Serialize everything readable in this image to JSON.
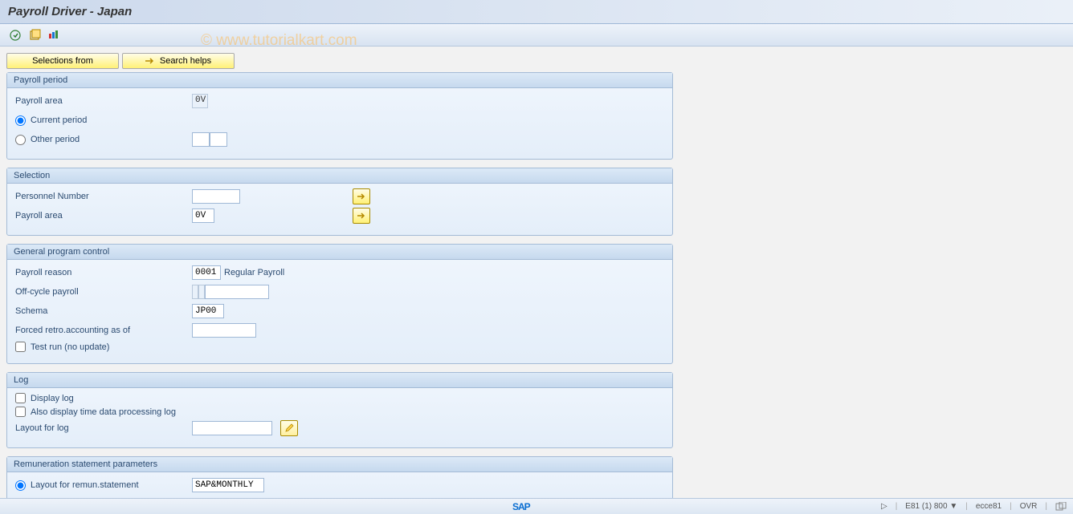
{
  "title": "Payroll Driver - Japan",
  "watermark": "© www.tutorialkart.com",
  "buttons": {
    "selections_from": "Selections from",
    "search_helps": "Search helps"
  },
  "panels": {
    "payroll_period": {
      "title": "Payroll period",
      "payroll_area_label": "Payroll area",
      "payroll_area_value": "0V",
      "current_period": "Current period",
      "other_period": "Other period"
    },
    "selection": {
      "title": "Selection",
      "personnel_number_label": "Personnel Number",
      "personnel_number_value": "",
      "payroll_area_label": "Payroll area",
      "payroll_area_value": "0V"
    },
    "general": {
      "title": "General program control",
      "payroll_reason_label": "Payroll reason",
      "payroll_reason_value": "0001",
      "payroll_reason_text": "Regular Payroll",
      "offcycle_label": "Off-cycle payroll",
      "offcycle_value1": "",
      "offcycle_value2": "",
      "schema_label": "Schema",
      "schema_value": "JP00",
      "forced_retro_label": "Forced retro.accounting as of",
      "forced_retro_value": "",
      "test_run": "Test run (no update)"
    },
    "log": {
      "title": "Log",
      "display_log": "Display log",
      "also_display": "Also display time data processing log",
      "layout_label": "Layout for log",
      "layout_value": ""
    },
    "remun": {
      "title": "Remuneration statement parameters",
      "layout_label": "Layout for remun.statement",
      "layout_value": "SAP&MONTHLY"
    }
  },
  "status": {
    "sap": "SAP",
    "system": "E81 (1) 800",
    "server": "ecce81",
    "mode": "OVR"
  }
}
